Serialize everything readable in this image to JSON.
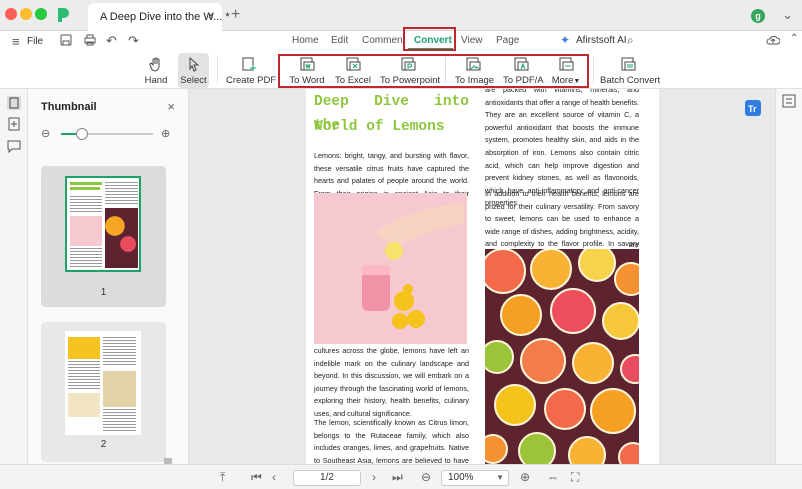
{
  "window": {
    "tab_title": "A Deep Dive into the W...",
    "tab_modified": "*",
    "tab_close": "×",
    "new_tab": "+",
    "avatar_letter": "g",
    "more": "⌄"
  },
  "menubar": {
    "file_label": "File",
    "tabs": [
      "Home",
      "Edit",
      "Comment",
      "Convert",
      "View",
      "Page"
    ],
    "active_tab": "Convert",
    "ai_label": "Afirstsoft AI"
  },
  "toolbar": {
    "hand": "Hand",
    "select": "Select",
    "create_pdf": "Create PDF",
    "to_word": "To Word",
    "to_excel": "To Excel",
    "to_powerpoint": "To Powerpoint",
    "to_image": "To Image",
    "to_pdfa": "To PDF/A",
    "more": "More",
    "batch_convert": "Batch Convert"
  },
  "thumbnail_panel": {
    "title": "Thumbnail",
    "zoom_level": 0.5,
    "pages": [
      "1",
      "2"
    ]
  },
  "document": {
    "heading_line1": "Deep Dive into the",
    "heading_line2": "World of Lemons",
    "left_para1": "Lemons: bright, tangy, and bursting with flavor, these versatile citrus fruits have captured the hearts and palates of people around the world. From their origins in ancient Asia to their widespread use in cuisines and",
    "left_para2": "cultures across the globe, lemons have left an indelible mark on the culinary landscape and beyond. In this discussion, we will embark on a journey through the fascinating world of lemons, exploring their history, health benefits, culinary uses, and cultural significance.",
    "left_para3": "The lemon, scientifically known as Citrus limon, belongs to the Rutaceae family, which also includes oranges, limes, and grapefruits. Native to Southeast Asia, lemons are believed to have been cultivated for",
    "right_para1": "are packed with vitamins, minerals, and antioxidants that offer a range of health benefits. They are an excellent source of vitamin C, a powerful antioxidant that boosts the immune system, promotes healthy skin, and aids in the absorption of iron. Lemons also contain citric acid, which can help improve digestion and prevent kidney stones, as well as flavonoids, which have anti-inflammatory and anti-cancer properties.",
    "right_para2": "In addition to their health benefits, lemons are prized for their culinary versatility. From savory to sweet, lemons can be used to enhance a wide range of dishes, adding brightness, acidity, and complexity to the flavor profile. In savory dishes, lemon zest and juice",
    "right_para2_end": "are"
  },
  "bottombar": {
    "page_value": "1/2",
    "zoom_value": "100%"
  },
  "colors": {
    "accent": "#1ba36a",
    "heading": "#8ec63f",
    "highlight_box": "#c0272d"
  }
}
